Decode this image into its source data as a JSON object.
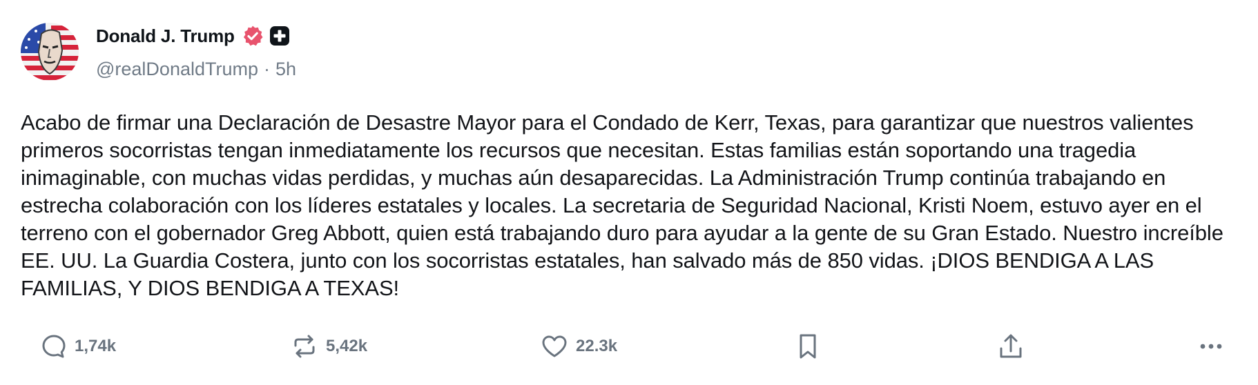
{
  "author": {
    "name": "Donald J. Trump",
    "handle": "@realDonaldTrump",
    "separator": "·",
    "time": "5h",
    "verified_color": "#e8536d",
    "plus_badge_color": "#0f1419"
  },
  "post": {
    "text": "Acabo de firmar una Declaración de Desastre Mayor para el Condado de Kerr, Texas, para garantizar que nuestros valientes primeros socorristas tengan inmediatamente los recursos que necesitan. Estas familias están soportando una tragedia inimaginable, con muchas vidas perdidas, y muchas aún desaparecidas. La Administración Trump continúa trabajando en estrecha colaboración con los líderes estatales y locales. La secretaria de Seguridad Nacional, Kristi Noem, estuvo ayer en el terreno con el gobernador Greg Abbott, quien está trabajando duro para ayudar a la gente de su Gran Estado. Nuestro increíble EE. UU. La Guardia Costera, junto con los socorristas estatales, han salvado más de 850 vidas. ¡DIOS BENDIGA A LAS FAMILIAS, Y DIOS BENDIGA A TEXAS!"
  },
  "actions": {
    "reply": {
      "icon": "reply-icon",
      "count": "1,74k"
    },
    "repost": {
      "icon": "repost-icon",
      "count": "5,42k"
    },
    "like": {
      "icon": "heart-icon",
      "count": "22.3k"
    },
    "bookmark": {
      "icon": "bookmark-icon"
    },
    "share": {
      "icon": "share-icon"
    },
    "more": {
      "icon": "more-icon"
    }
  },
  "colors": {
    "text": "#121418",
    "muted": "#707b87",
    "icon": "#69737e"
  }
}
